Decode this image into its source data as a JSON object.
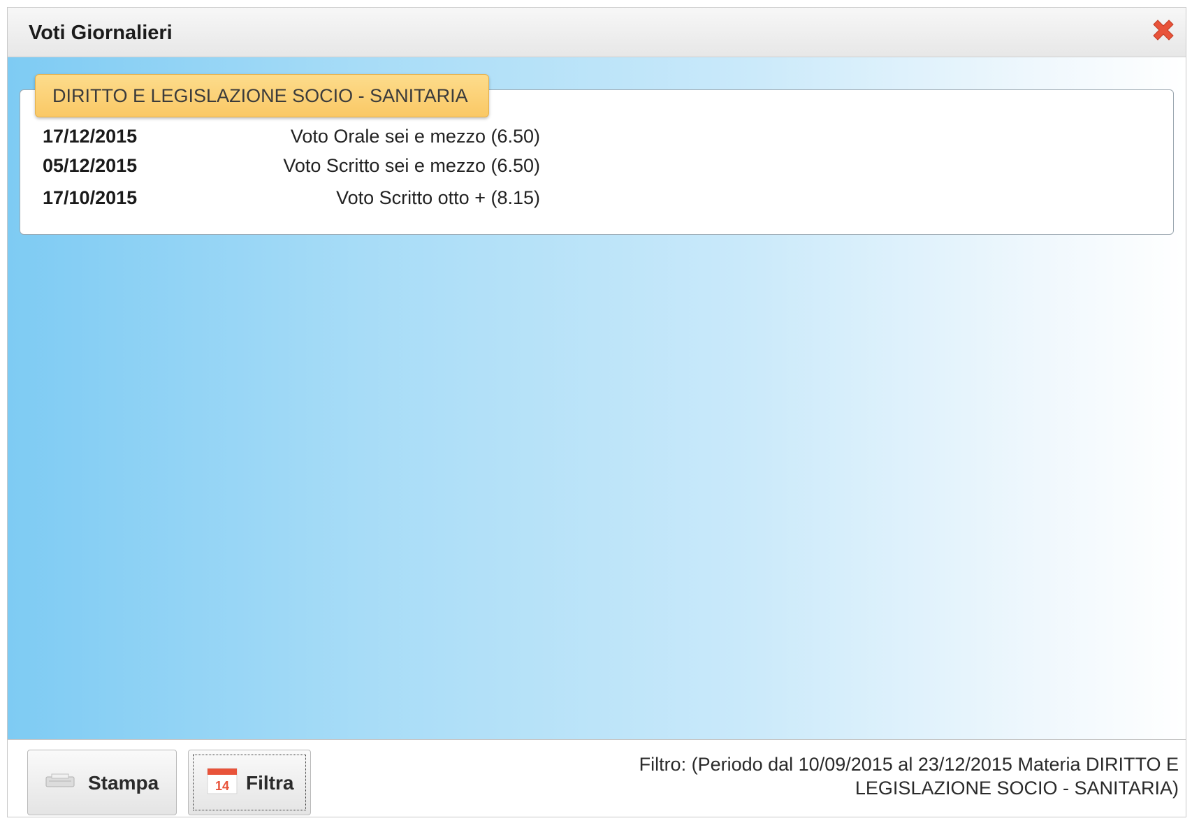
{
  "window": {
    "title": "Voti Giornalieri",
    "close_icon": "close-x-icon",
    "close_color": "#e8533a"
  },
  "subject": {
    "name": "DIRITTO E LEGISLAZIONE SOCIO - SANITARIA",
    "grades": [
      {
        "date": "17/12/2015",
        "description": "Voto Orale sei e mezzo (6.50)"
      },
      {
        "date": "05/12/2015",
        "description": "Voto Scritto sei e mezzo (6.50)"
      },
      {
        "date": "17/10/2015",
        "description": "Voto Scritto otto + (8.15)"
      }
    ]
  },
  "footer": {
    "print_label": "Stampa",
    "print_icon": "printer-icon",
    "filter_label": "Filtra",
    "filter_icon": "calendar-icon",
    "calendar_day": "14",
    "filter_line1": "Filtro: (Periodo dal 10/09/2015 al 23/12/2015 Materia DIRITTO E",
    "filter_line2": "LEGISLAZIONE SOCIO - SANITARIA)"
  },
  "colors": {
    "legend_bg": "#fac865",
    "accent_blue": "#7ecbf3"
  }
}
